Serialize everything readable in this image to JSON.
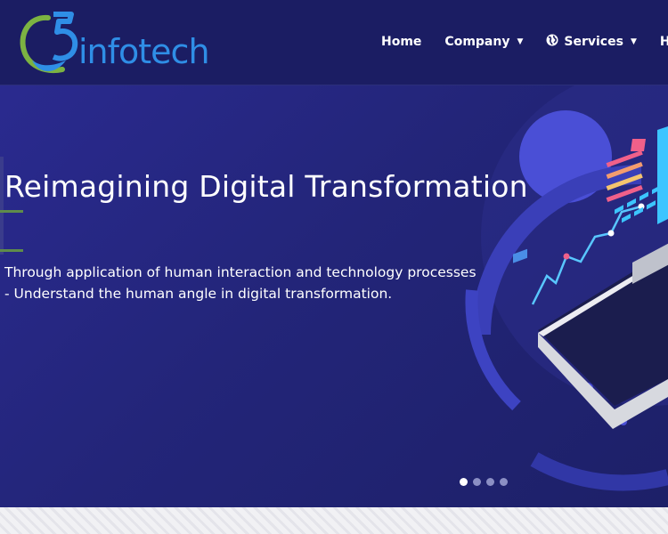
{
  "brand": {
    "logo_text": "infotech",
    "logo_digit": "5"
  },
  "nav": {
    "home": "Home",
    "company": "Company",
    "services": "Services",
    "hire": "Hire"
  },
  "hero": {
    "title": "Reimagining Digital Transformation",
    "subtitle_line1": "Through application of human interaction and technology processes",
    "subtitle_line2": "- Understand the human angle in digital transformation.",
    "slides_total": 4,
    "active_slide": 1
  },
  "colors": {
    "header_bg": "#1b1d63",
    "hero_bg": "#25277d",
    "logo_blue": "#2f8ee6",
    "logo_green": "#7cb342"
  },
  "icons": [
    "globe-icon",
    "caret-down-icon"
  ]
}
